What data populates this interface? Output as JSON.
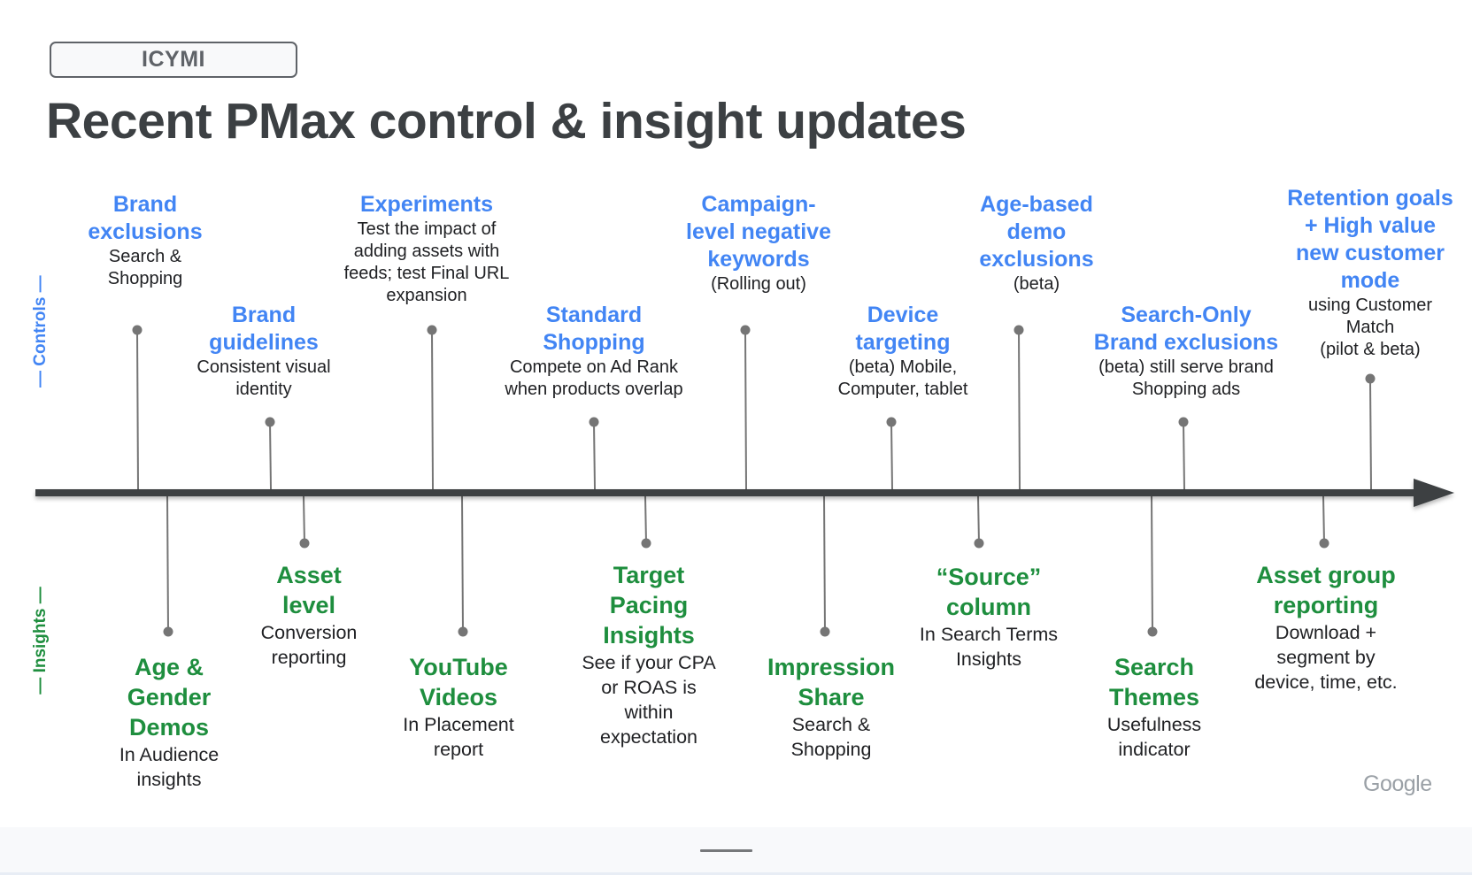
{
  "tag": "ICYMI",
  "title": "Recent PMax control & insight updates",
  "side_labels": {
    "controls": "— Controls —",
    "insights": "— Insights —"
  },
  "colors": {
    "controls": "#4285f4",
    "insights": "#1e8e3e",
    "axis": "#3c4043",
    "stem": "#757575",
    "title": "#3c4043"
  },
  "controls": [
    {
      "heading": [
        "Brand",
        "exclusions"
      ],
      "body": [
        "Search &",
        "Shopping"
      ]
    },
    {
      "heading": [
        "Brand",
        "guidelines"
      ],
      "body": [
        "Consistent visual",
        "identity"
      ]
    },
    {
      "heading": [
        "Experiments"
      ],
      "body": [
        "Test the impact of",
        "adding assets with",
        "feeds; test Final URL",
        "expansion"
      ]
    },
    {
      "heading": [
        "Standard",
        "Shopping"
      ],
      "body": [
        "Compete on Ad Rank",
        "when products overlap"
      ]
    },
    {
      "heading": [
        "Campaign-",
        "level negative",
        "keywords"
      ],
      "body": [
        "(Rolling out)"
      ]
    },
    {
      "heading": [
        "Device",
        "targeting"
      ],
      "body": [
        "(beta) Mobile,",
        "Computer, tablet"
      ]
    },
    {
      "heading": [
        "Age-based",
        "demo",
        "exclusions"
      ],
      "body": [
        "(beta)"
      ]
    },
    {
      "heading": [
        "Search-Only",
        "Brand exclusions"
      ],
      "body": [
        "(beta) still serve brand",
        "Shopping ads"
      ]
    },
    {
      "heading": [
        "Retention goals",
        "+ High value",
        "new customer",
        "mode"
      ],
      "body": [
        "using Customer",
        "Match",
        "(pilot & beta)"
      ]
    }
  ],
  "insights": [
    {
      "heading": [
        "Age &",
        "Gender",
        "Demos"
      ],
      "body": [
        "In Audience",
        "insights"
      ]
    },
    {
      "heading": [
        "Asset",
        "level"
      ],
      "body": [
        "Conversion",
        "reporting"
      ]
    },
    {
      "heading": [
        "YouTube",
        "Videos"
      ],
      "body": [
        "In Placement",
        "report"
      ]
    },
    {
      "heading": [
        "Target",
        "Pacing",
        "Insights"
      ],
      "body": [
        "See if your CPA",
        "or ROAS is",
        "within",
        "expectation"
      ]
    },
    {
      "heading": [
        "Impression",
        "Share"
      ],
      "body": [
        "Search &",
        "Shopping"
      ]
    },
    {
      "heading": [
        "“Source”",
        "column"
      ],
      "body": [
        "In Search Terms",
        "Insights"
      ]
    },
    {
      "heading": [
        "Search",
        "Themes"
      ],
      "body": [
        "Usefulness",
        "indicator"
      ]
    },
    {
      "heading": [
        "Asset group",
        "reporting"
      ],
      "body": [
        "Download +",
        "segment by",
        "device, time, etc."
      ]
    }
  ],
  "brand": "Google"
}
